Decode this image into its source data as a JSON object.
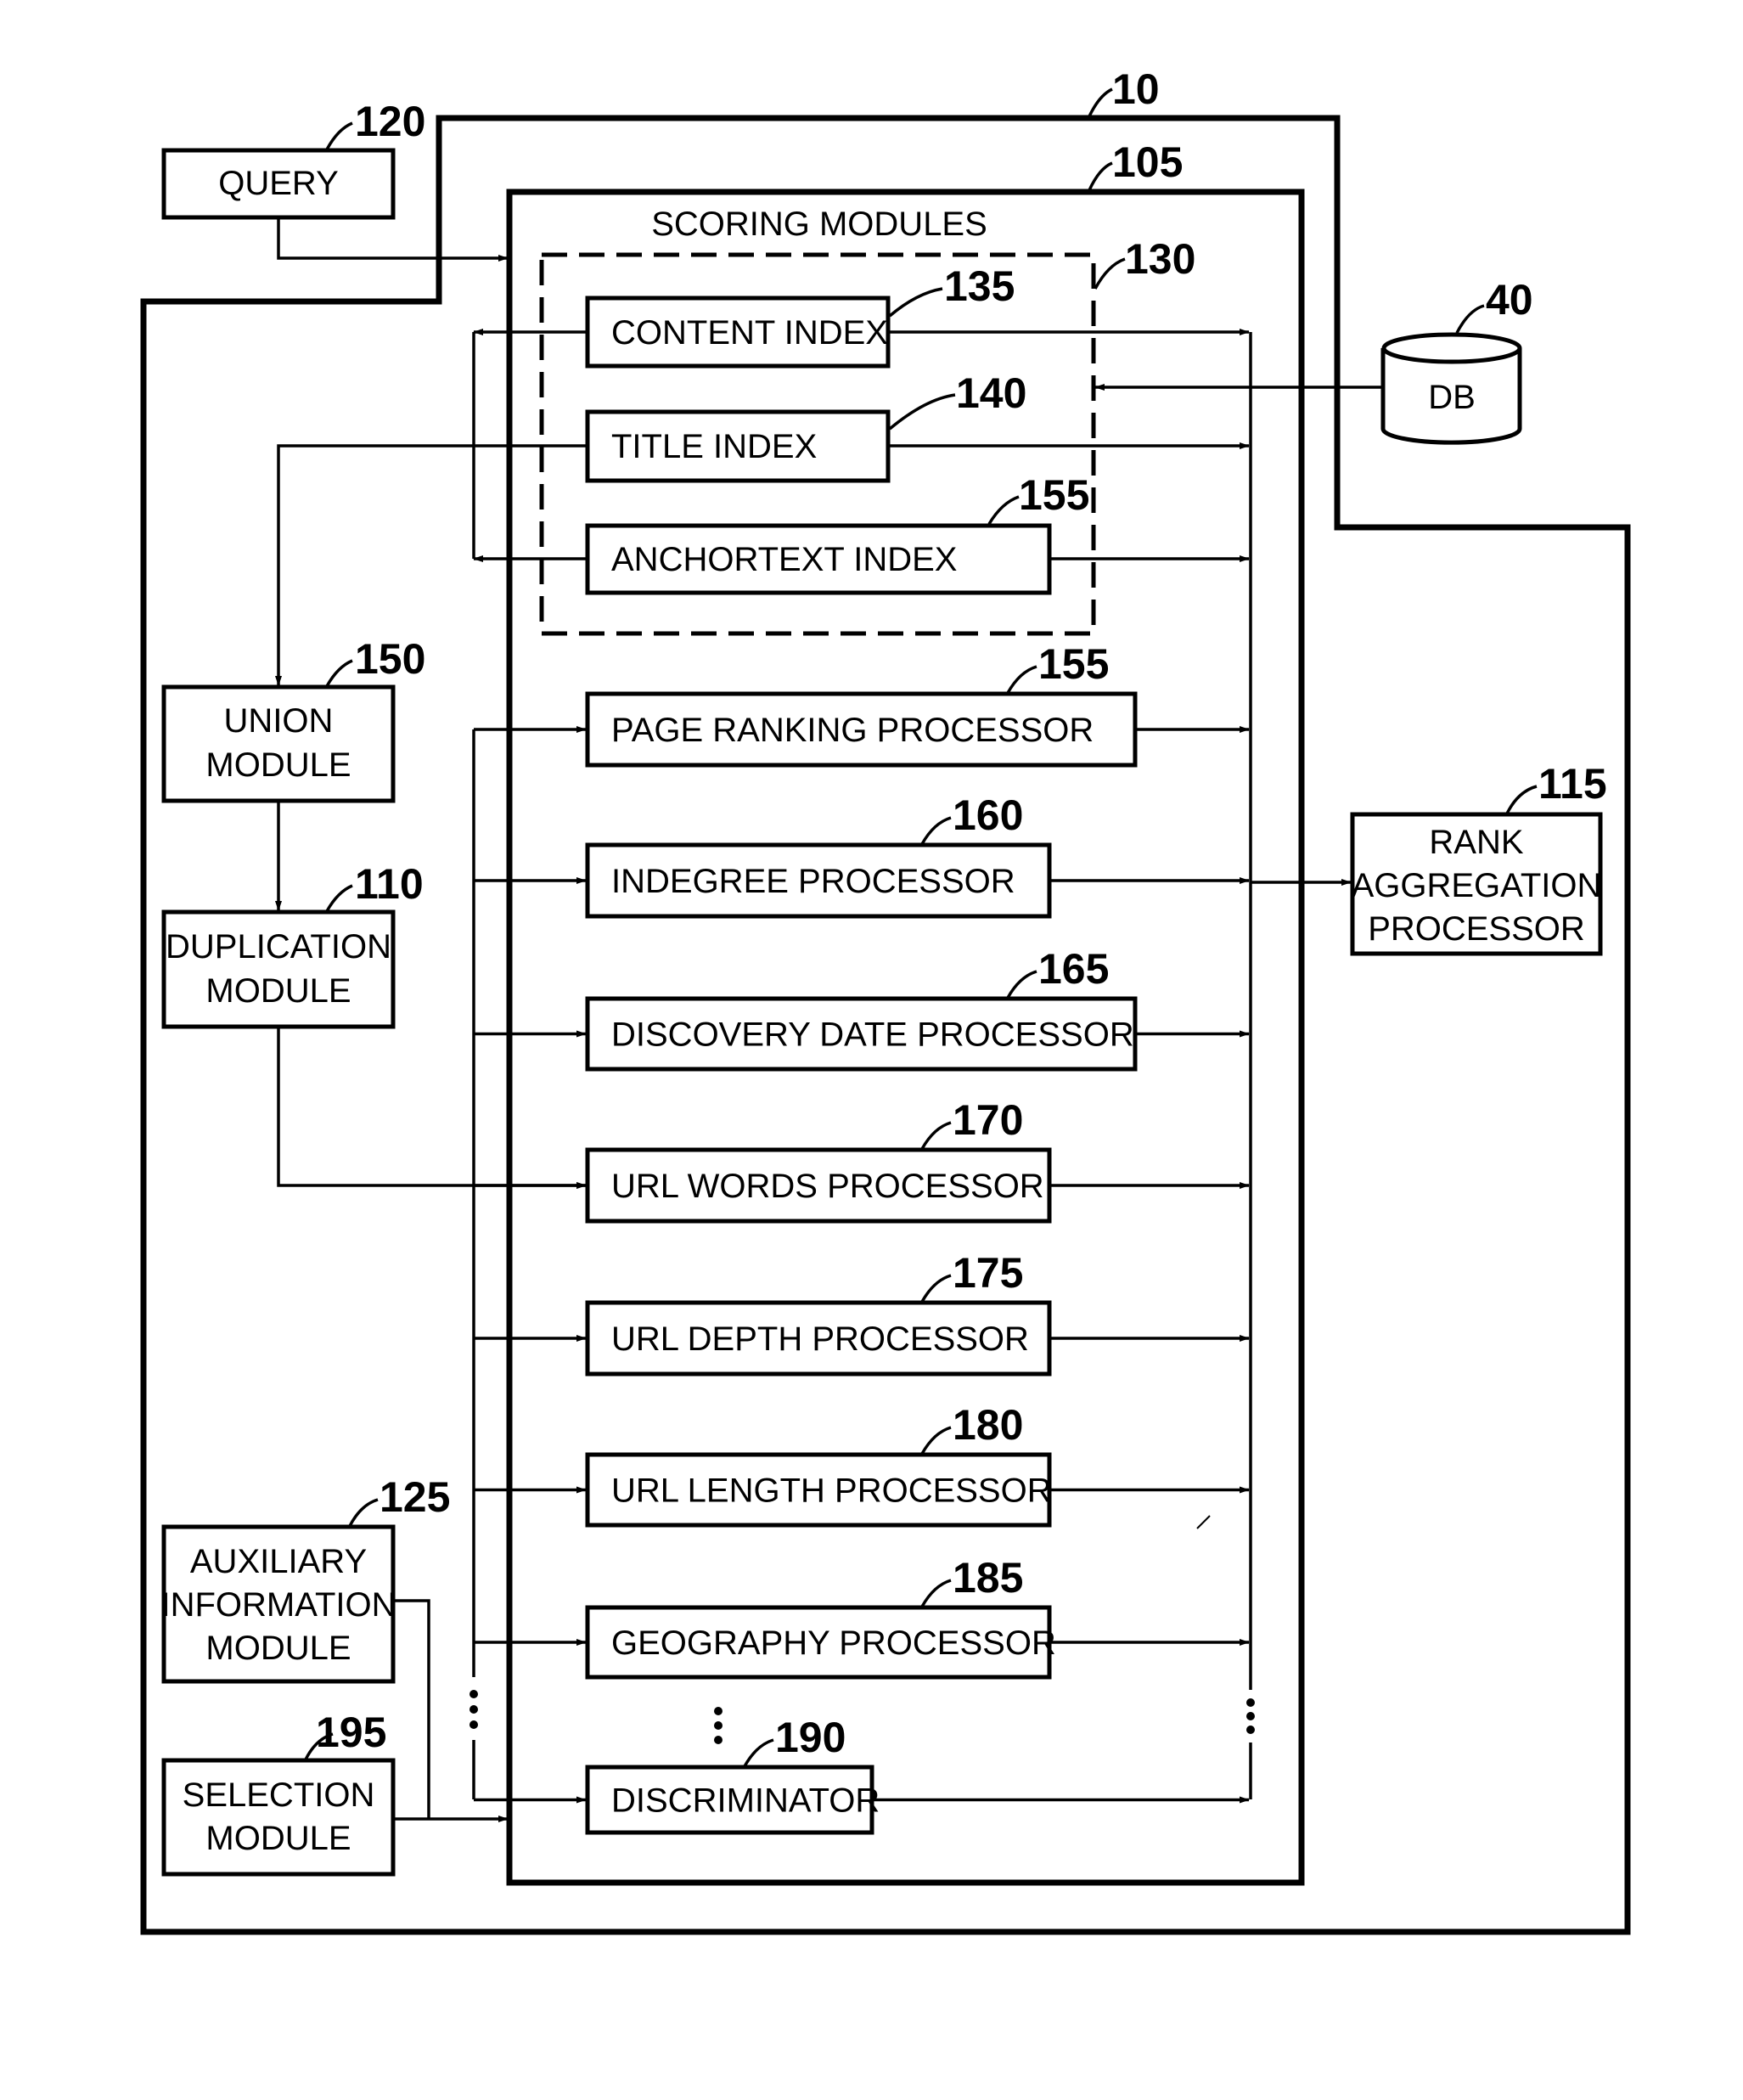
{
  "figure": {
    "system_ref": "10",
    "scoring_container": {
      "ref": "105",
      "title": "SCORING MODULES"
    },
    "index_group": {
      "ref": "130"
    },
    "query": {
      "label": "QUERY",
      "ref": "120"
    },
    "db": {
      "label": "DB",
      "ref": "40"
    },
    "indexes": [
      {
        "label": "CONTENT INDEX",
        "ref": "135"
      },
      {
        "label": "TITLE INDEX",
        "ref": "140"
      },
      {
        "label": "ANCHORTEXT INDEX",
        "ref": "155"
      }
    ],
    "processors": [
      {
        "label": "PAGE RANKING PROCESSOR",
        "ref": "155"
      },
      {
        "label": "INDEGREE PROCESSOR",
        "ref": "160"
      },
      {
        "label": "DISCOVERY DATE PROCESSOR",
        "ref": "165"
      },
      {
        "label": "URL WORDS PROCESSOR",
        "ref": "170"
      },
      {
        "label": "URL DEPTH PROCESSOR",
        "ref": "175"
      },
      {
        "label": "URL LENGTH PROCESSOR",
        "ref": "180"
      },
      {
        "label": "GEOGRAPHY PROCESSOR",
        "ref": "185"
      },
      {
        "label": "DISCRIMINATOR",
        "ref": "190"
      }
    ],
    "union_module": {
      "line1": "UNION",
      "line2": "MODULE",
      "ref": "150"
    },
    "duplication_module": {
      "line1": "DUPLICATION",
      "line2": "MODULE",
      "ref": "110"
    },
    "rank_aggregation": {
      "line1": "RANK",
      "line2": "AGGREGATION",
      "line3": "PROCESSOR",
      "ref": "115"
    },
    "auxiliary_module": {
      "line1": "AUXILIARY",
      "line2": "INFORMATION",
      "line3": "MODULE",
      "ref": "125"
    },
    "selection_module": {
      "line1": "SELECTION",
      "line2": "MODULE",
      "ref": "195"
    }
  }
}
